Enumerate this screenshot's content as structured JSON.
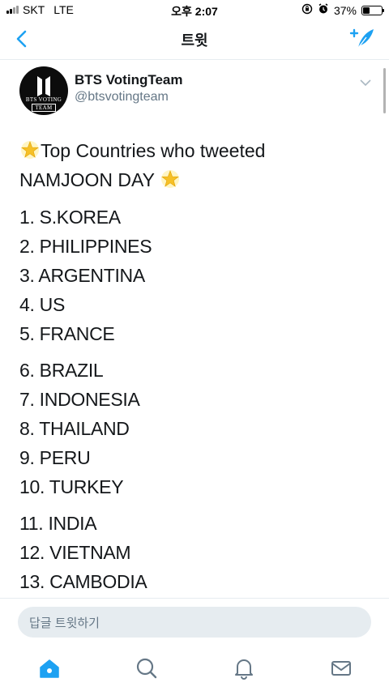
{
  "status_bar": {
    "carrier": "SKT",
    "network": "LTE",
    "time": "오후 2:07",
    "battery_percent_label": "37%",
    "battery_level": 0.37
  },
  "nav": {
    "title": "트윗",
    "accent_color": "#1da1f2"
  },
  "tweet": {
    "display_name": "BTS VotingTeam",
    "handle": "@btsvotingteam",
    "avatar_text": [
      "BTS VOTING",
      "TEAM"
    ],
    "text_line_1": "Top Countries who tweeted",
    "text_line_2": "NAMJOON DAY",
    "rankings": [
      [
        "1. S.KOREA",
        "2. PHILIPPINES",
        "3. ARGENTINA",
        "4. US",
        "5. FRANCE"
      ],
      [
        "6. BRAZIL",
        "7. INDONESIA",
        "8. THAILAND",
        "9. PERU",
        "10. TURKEY"
      ],
      [
        "11. INDIA",
        "12. VIETNAM",
        "13. CAMBODIA"
      ]
    ]
  },
  "reply": {
    "placeholder": "답글 트윗하기"
  },
  "tab_bar": {
    "items": [
      "home-icon",
      "search-icon",
      "notifications-icon",
      "messages-icon"
    ],
    "active": "home-icon"
  }
}
